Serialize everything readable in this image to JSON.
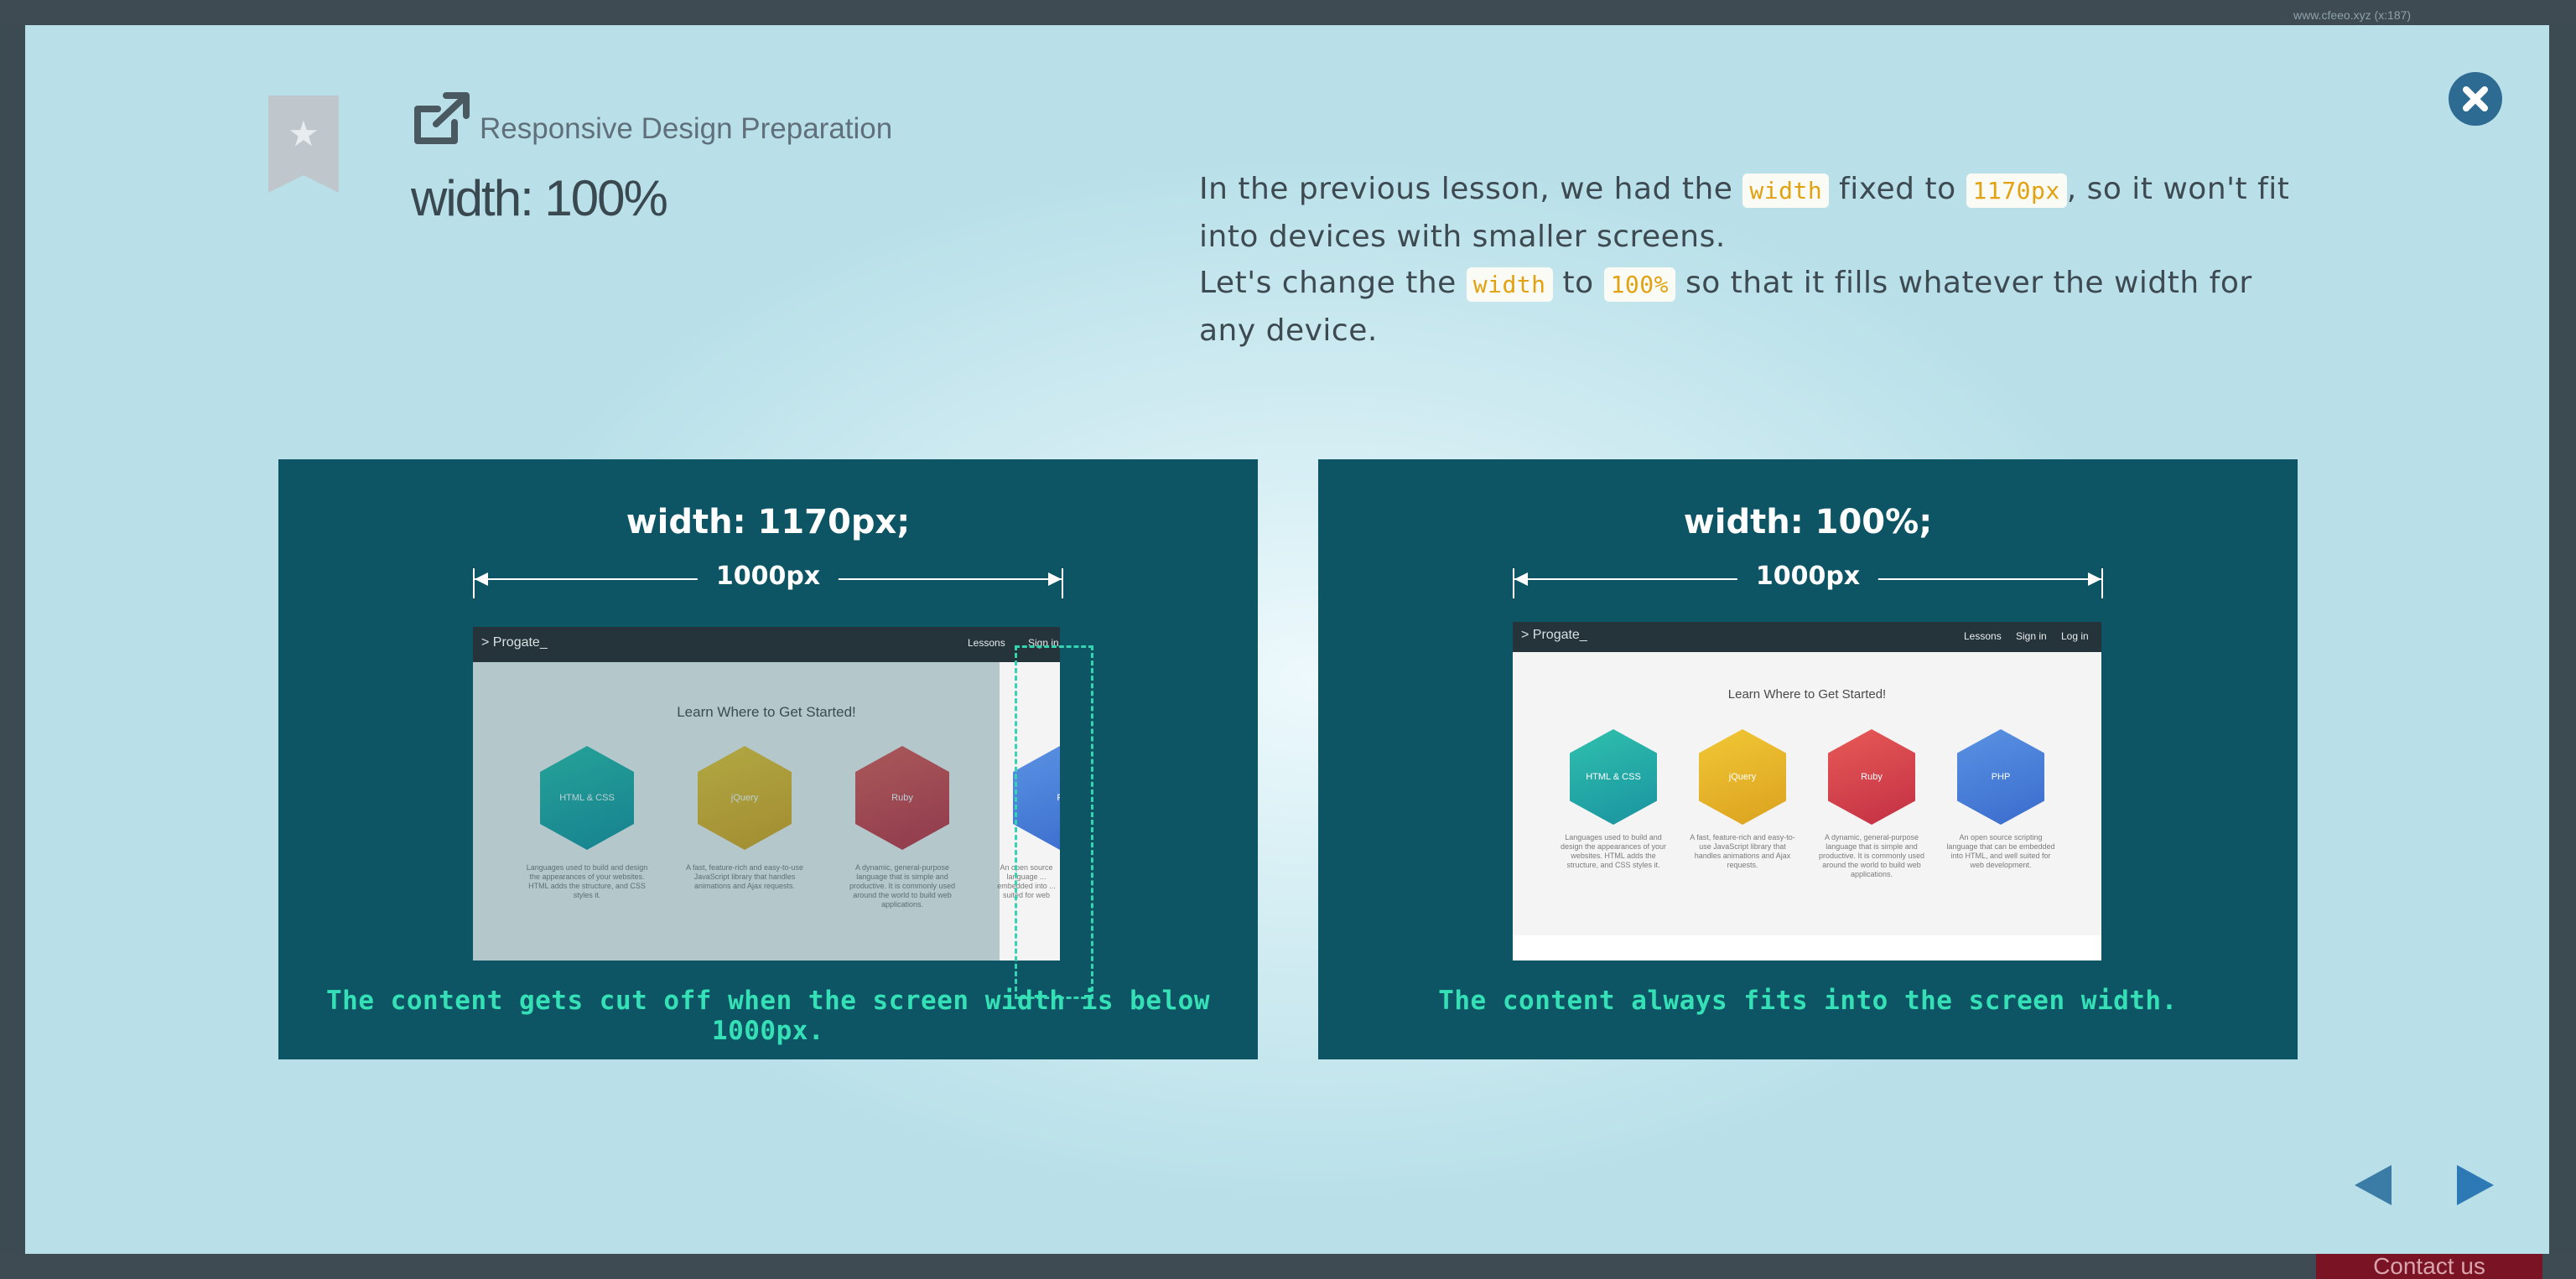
{
  "background": {
    "url_text": "www.cfeeo.xyz (x:187)",
    "contact_label": "Contact us"
  },
  "header": {
    "category": "Responsive Design Preparation",
    "title": "width: 100%"
  },
  "description": {
    "p1_a": "In the previous lesson, we had the ",
    "p1_code1": "width",
    "p1_b": " fixed to ",
    "p1_code2": "1170px",
    "p1_c": ", so it won't fit into devices with smaller screens.",
    "p2_a": "Let's change the ",
    "p2_code1": "width",
    "p2_b": " to ",
    "p2_code2": "100%",
    "p2_c": " so that it fills whatever the width for any device."
  },
  "panels": {
    "left": {
      "title": "width: 1170px;",
      "dimension": "1000px",
      "caption": "The content gets cut off when the screen width is below 1000px.",
      "mock": {
        "logo": "> Progate_",
        "nav": [
          "Lessons",
          "Sign in"
        ],
        "heading": "Learn Where to Get Started!",
        "cards": [
          {
            "label": "HTML & CSS",
            "desc": "Languages used to build and design the appearances of your websites. HTML adds the structure, and CSS styles it."
          },
          {
            "label": "jQuery",
            "desc": "A fast, feature-rich and easy-to-use JavaScript library that handles animations and Ajax requests."
          },
          {
            "label": "Ruby",
            "desc": "A dynamic, general-purpose language that is simple and productive. It is commonly used around the world to build web applications."
          },
          {
            "label": "P",
            "desc": "An open source language ... embedded into ... suited for web"
          }
        ]
      }
    },
    "right": {
      "title": "width: 100%;",
      "dimension": "1000px",
      "caption": "The content always fits into the screen width.",
      "mock": {
        "logo": "> Progate_",
        "nav": [
          "Lessons",
          "Sign in",
          "Log in"
        ],
        "heading": "Learn Where to Get Started!",
        "cards": [
          {
            "label": "HTML & CSS",
            "desc": "Languages used to build and design the appearances of your websites. HTML adds the structure, and CSS styles it."
          },
          {
            "label": "jQuery",
            "desc": "A fast, feature-rich and easy-to-use JavaScript library that handles animations and Ajax requests."
          },
          {
            "label": "Ruby",
            "desc": "A dynamic, general-purpose language that is simple and productive. It is commonly used around the world to build web applications."
          },
          {
            "label": "PHP",
            "desc": "An open source scripting language that can be embedded into HTML, and well suited for web development."
          }
        ]
      }
    }
  },
  "colors": {
    "panel_bg": "#0d5564",
    "caption": "#36e0b6",
    "code_text": "#e2a10f",
    "close_button": "#2d6b92",
    "nav_arrows": "#2d79a6",
    "hex_html": "#28b3a8",
    "hex_jquery": "#e7b72a",
    "hex_ruby": "#d9444d",
    "hex_php": "#4a7fd6"
  },
  "icons": {
    "bookmark": "bookmark-star-icon",
    "external": "external-link-icon",
    "close": "close-icon",
    "prev": "triangle-left-icon",
    "next": "triangle-right-icon"
  }
}
